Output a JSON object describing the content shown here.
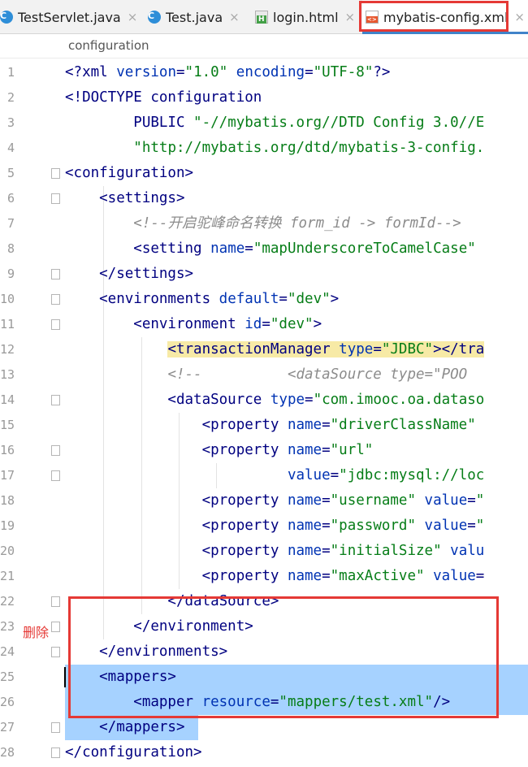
{
  "tabs": [
    {
      "label": "TestServlet.java",
      "icon": "java-class-icon",
      "active": false
    },
    {
      "label": "Test.java",
      "icon": "java-class-icon",
      "active": false
    },
    {
      "label": "login.html",
      "icon": "html-file-icon",
      "active": false
    },
    {
      "label": "mybatis-config.xml",
      "icon": "xml-file-icon",
      "active": true
    }
  ],
  "close_glyph": "×",
  "breadcrumb": "configuration",
  "annotation": {
    "label": "删除",
    "color": "#e53935"
  },
  "colors": {
    "tag": "#000080",
    "attr": "#0033b3",
    "value": "#067d17",
    "comment": "#8c8c8c",
    "selection": "#a6d2ff",
    "highlight": "#f7eaa6",
    "accent": "#4083c9"
  },
  "code_lines": [
    {
      "n": "1",
      "fold": false,
      "tokens": [
        {
          "t": "<?",
          "c": "t"
        },
        {
          "t": "xml ",
          "c": "t"
        },
        {
          "t": "version",
          "c": "a"
        },
        {
          "t": "=",
          "c": "t"
        },
        {
          "t": "\"1.0\"",
          "c": "v"
        },
        {
          "t": " ",
          "c": "t"
        },
        {
          "t": "encoding",
          "c": "a"
        },
        {
          "t": "=",
          "c": "t"
        },
        {
          "t": "\"UTF-8\"",
          "c": "v"
        },
        {
          "t": "?>",
          "c": "t"
        }
      ]
    },
    {
      "n": "2",
      "fold": false,
      "tokens": [
        {
          "t": "<!DOCTYPE configuration",
          "c": "t"
        }
      ]
    },
    {
      "n": "3",
      "fold": false,
      "tokens": [
        {
          "t": "        PUBLIC ",
          "c": "t"
        },
        {
          "t": "\"-//mybatis.org//DTD Config 3.0//E",
          "c": "v"
        }
      ]
    },
    {
      "n": "4",
      "fold": false,
      "tokens": [
        {
          "t": "        ",
          "c": "t"
        },
        {
          "t": "\"http://mybatis.org/dtd/mybatis-3-config.",
          "c": "v"
        }
      ]
    },
    {
      "n": "5",
      "fold": true,
      "tokens": [
        {
          "t": "<configuration>",
          "c": "t"
        }
      ]
    },
    {
      "n": "6",
      "fold": true,
      "tokens": [
        {
          "t": "    <settings>",
          "c": "t"
        }
      ]
    },
    {
      "n": "7",
      "fold": false,
      "tokens": [
        {
          "t": "        ",
          "c": "t"
        },
        {
          "t": "<!--开启驼峰命名转换 form_id -> formId-->",
          "c": "c"
        }
      ]
    },
    {
      "n": "8",
      "fold": false,
      "tokens": [
        {
          "t": "        <setting ",
          "c": "t"
        },
        {
          "t": "name",
          "c": "a"
        },
        {
          "t": "=",
          "c": "t"
        },
        {
          "t": "\"mapUnderscoreToCamelCase\"",
          "c": "v"
        }
      ]
    },
    {
      "n": "9",
      "fold": true,
      "tokens": [
        {
          "t": "    </settings>",
          "c": "t"
        }
      ]
    },
    {
      "n": "10",
      "fold": true,
      "tokens": [
        {
          "t": "    <environments ",
          "c": "t"
        },
        {
          "t": "default",
          "c": "a"
        },
        {
          "t": "=",
          "c": "t"
        },
        {
          "t": "\"dev\"",
          "c": "v"
        },
        {
          "t": ">",
          "c": "t"
        }
      ]
    },
    {
      "n": "11",
      "fold": true,
      "tokens": [
        {
          "t": "        <environment ",
          "c": "t"
        },
        {
          "t": "id",
          "c": "a"
        },
        {
          "t": "=",
          "c": "t"
        },
        {
          "t": "\"dev\"",
          "c": "v"
        },
        {
          "t": ">",
          "c": "t"
        }
      ]
    },
    {
      "n": "12",
      "fold": false,
      "tokens": [
        {
          "t": "            ",
          "c": "t"
        },
        {
          "t": "<transactionManager ",
          "c": "t hl-tm"
        },
        {
          "t": "type",
          "c": "a hl-tm"
        },
        {
          "t": "=",
          "c": "t hl-tm"
        },
        {
          "t": "\"JDBC\"",
          "c": "v hl-tm"
        },
        {
          "t": "></tra",
          "c": "t hl-tm"
        }
      ]
    },
    {
      "n": "13",
      "fold": false,
      "tokens": [
        {
          "t": "            ",
          "c": "t"
        },
        {
          "t": "<!--          <dataSource type=\"POO",
          "c": "c"
        }
      ]
    },
    {
      "n": "14",
      "fold": true,
      "tokens": [
        {
          "t": "            <dataSource ",
          "c": "t"
        },
        {
          "t": "type",
          "c": "a"
        },
        {
          "t": "=",
          "c": "t"
        },
        {
          "t": "\"com.imooc.oa.dataso",
          "c": "v"
        }
      ]
    },
    {
      "n": "15",
      "fold": false,
      "tokens": [
        {
          "t": "                <property ",
          "c": "t"
        },
        {
          "t": "name",
          "c": "a"
        },
        {
          "t": "=",
          "c": "t"
        },
        {
          "t": "\"driverClassName\"",
          "c": "v"
        }
      ]
    },
    {
      "n": "16",
      "fold": true,
      "tokens": [
        {
          "t": "                <property ",
          "c": "t"
        },
        {
          "t": "name",
          "c": "a"
        },
        {
          "t": "=",
          "c": "t"
        },
        {
          "t": "\"url\"",
          "c": "v"
        }
      ]
    },
    {
      "n": "17",
      "fold": true,
      "tokens": [
        {
          "t": "                          ",
          "c": "t"
        },
        {
          "t": "value",
          "c": "a"
        },
        {
          "t": "=",
          "c": "t"
        },
        {
          "t": "\"jdbc:mysql://loc",
          "c": "v"
        }
      ]
    },
    {
      "n": "18",
      "fold": false,
      "tokens": [
        {
          "t": "                <property ",
          "c": "t"
        },
        {
          "t": "name",
          "c": "a"
        },
        {
          "t": "=",
          "c": "t"
        },
        {
          "t": "\"username\"",
          "c": "v"
        },
        {
          "t": " ",
          "c": "t"
        },
        {
          "t": "value",
          "c": "a"
        },
        {
          "t": "=",
          "c": "t"
        },
        {
          "t": "\"",
          "c": "v"
        }
      ]
    },
    {
      "n": "19",
      "fold": false,
      "tokens": [
        {
          "t": "                <property ",
          "c": "t"
        },
        {
          "t": "name",
          "c": "a"
        },
        {
          "t": "=",
          "c": "t"
        },
        {
          "t": "\"password\"",
          "c": "v"
        },
        {
          "t": " ",
          "c": "t"
        },
        {
          "t": "value",
          "c": "a"
        },
        {
          "t": "=",
          "c": "t"
        },
        {
          "t": "\"",
          "c": "v"
        }
      ]
    },
    {
      "n": "20",
      "fold": false,
      "tokens": [
        {
          "t": "                <property ",
          "c": "t"
        },
        {
          "t": "name",
          "c": "a"
        },
        {
          "t": "=",
          "c": "t"
        },
        {
          "t": "\"initialSize\"",
          "c": "v"
        },
        {
          "t": " ",
          "c": "t"
        },
        {
          "t": "valu",
          "c": "a"
        }
      ]
    },
    {
      "n": "21",
      "fold": false,
      "tokens": [
        {
          "t": "                <property ",
          "c": "t"
        },
        {
          "t": "name",
          "c": "a"
        },
        {
          "t": "=",
          "c": "t"
        },
        {
          "t": "\"maxActive\"",
          "c": "v"
        },
        {
          "t": " ",
          "c": "t"
        },
        {
          "t": "value",
          "c": "a"
        },
        {
          "t": "=",
          "c": "t"
        }
      ]
    },
    {
      "n": "22",
      "fold": true,
      "tokens": [
        {
          "t": "            </dataSource>",
          "c": "t"
        }
      ]
    },
    {
      "n": "23",
      "fold": true,
      "tokens": [
        {
          "t": "        </environment>",
          "c": "t"
        }
      ]
    },
    {
      "n": "24",
      "fold": true,
      "tokens": [
        {
          "t": "    </environments>",
          "c": "t"
        }
      ]
    },
    {
      "n": "25",
      "fold": false,
      "tokens": [
        {
          "t": "    <mappers>",
          "c": "t"
        }
      ]
    },
    {
      "n": "26",
      "fold": false,
      "tokens": [
        {
          "t": "        <mapper ",
          "c": "t"
        },
        {
          "t": "resource",
          "c": "a"
        },
        {
          "t": "=",
          "c": "t"
        },
        {
          "t": "\"mappers/test.xml\"",
          "c": "v"
        },
        {
          "t": "/>",
          "c": "t"
        }
      ]
    },
    {
      "n": "27",
      "fold": true,
      "tokens": [
        {
          "t": "    </mappers>",
          "c": "t"
        }
      ]
    },
    {
      "n": "28",
      "fold": true,
      "tokens": [
        {
          "t": "</configuration>",
          "c": "t"
        }
      ]
    }
  ]
}
